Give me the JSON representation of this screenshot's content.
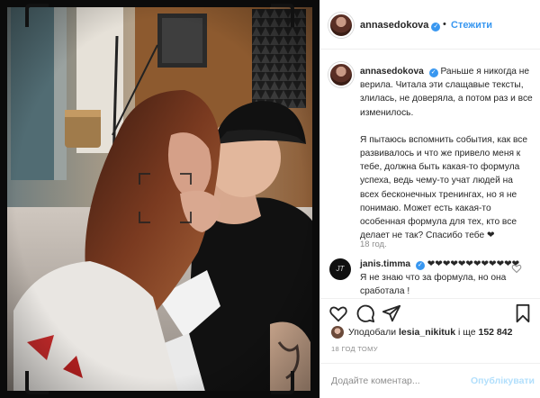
{
  "post": {
    "username": "annasedokova",
    "verified_mark": "✓",
    "follow_separator": "•",
    "follow_label": "Стежити"
  },
  "caption": {
    "username": "annasedokova",
    "text_1": "Раньше я никогда не верила. Читала эти слащавые тексты, злилась, не доверяла, а потом раз и все изменилось.",
    "text_2": "Я пытаюсь вспомнить события, как все развивалось и что же привело меня к тебе, должна быть какая-то формула успеха, ведь чему-то учат людей на всех бесконечных тренингах, но я не понимаю. Может есть какая-то особенная формула для тех, кто все делает не так? Спасибо тебе ❤",
    "time": "18 год."
  },
  "comment": {
    "username": "janis.timma",
    "text": "❤❤❤❤❤❤❤❤❤❤❤❤ Я не знаю что за формула, но она сработала !",
    "avatar_label": "JT"
  },
  "actions": {
    "icons": [
      "heart-icon",
      "comment-icon",
      "share-icon",
      "bookmark-icon"
    ]
  },
  "likes": {
    "prefix": "Уподобали",
    "user": "lesia_nikituk",
    "suffix": "і ще",
    "count": "152 842"
  },
  "date": "18 ГОД ТОМУ",
  "add_comment": {
    "placeholder": "Додайте коментар...",
    "post_label": "Опублікувати"
  },
  "colors": {
    "accent": "#3897f0",
    "muted": "#8e8e8e",
    "text": "#262626",
    "post_disabled": "#b2dffc"
  }
}
